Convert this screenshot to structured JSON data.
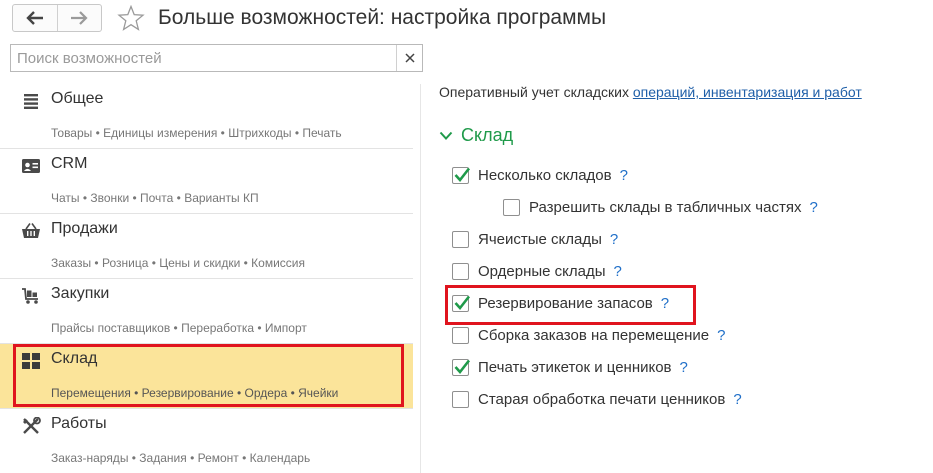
{
  "header": {
    "title": "Больше возможностей: настройка программы",
    "back_icon": "arrow-left-icon",
    "forward_icon": "arrow-right-icon",
    "favorite_icon": "star-icon"
  },
  "search": {
    "placeholder": "Поиск возможностей",
    "value": "",
    "clear_label": "×"
  },
  "sidebar": {
    "sections": [
      {
        "title": "Общее",
        "subtitle": "Товары • Единицы измерения • Штрихкоды • Печать",
        "icon": "list-icon"
      },
      {
        "title": "CRM",
        "subtitle": "Чаты • Звонки • Почта • Варианты КП",
        "icon": "contact-card-icon"
      },
      {
        "title": "Продажи",
        "subtitle": "Заказы • Розница • Цены и скидки • Комиссия",
        "icon": "basket-icon"
      },
      {
        "title": "Закупки",
        "subtitle": "Прайсы поставщиков • Переработка • Импорт",
        "icon": "cart-icon"
      },
      {
        "title": "Склад",
        "subtitle": "Перемещения • Резервирование • Ордера • Ячейки",
        "icon": "warehouse-grid-icon",
        "selected": true
      },
      {
        "title": "Работы",
        "subtitle": "Заказ-наряды • Задания • Ремонт • Календарь",
        "icon": "tools-icon"
      }
    ]
  },
  "main": {
    "intro_text": "Оперативный учет складских ",
    "intro_link": "операций, инвентаризация и работ",
    "group_title": "Склад",
    "help_label": "?",
    "options": [
      {
        "label": "Несколько складов",
        "checked": true
      },
      {
        "label": "Разрешить склады в табличных частях",
        "checked": false,
        "indent": true
      },
      {
        "label": "Ячеистые склады",
        "checked": false
      },
      {
        "label": "Ордерные склады",
        "checked": false
      },
      {
        "label": "Резервирование запасов",
        "checked": true,
        "highlighted": true
      },
      {
        "label": "Сборка заказов на перемещение",
        "checked": false
      },
      {
        "label": "Печать этикеток и ценников",
        "checked": true
      },
      {
        "label": "Старая обработка печати ценников",
        "checked": false
      }
    ]
  },
  "colors": {
    "accent_green": "#1f9a4a",
    "link_blue": "#1f5fa8",
    "highlight_red": "#e0141e",
    "selected_bg": "#fbe49a"
  }
}
